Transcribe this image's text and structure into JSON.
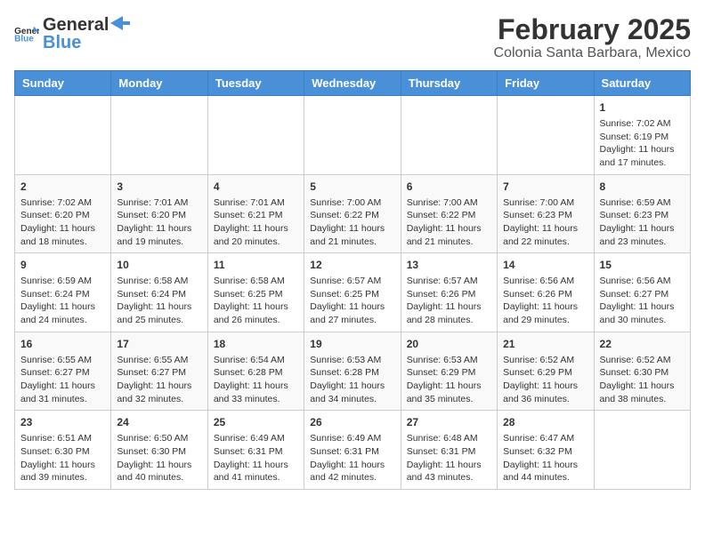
{
  "header": {
    "logo_general": "General",
    "logo_blue": "Blue",
    "title": "February 2025",
    "subtitle": "Colonia Santa Barbara, Mexico"
  },
  "weekdays": [
    "Sunday",
    "Monday",
    "Tuesday",
    "Wednesday",
    "Thursday",
    "Friday",
    "Saturday"
  ],
  "weeks": [
    [
      {
        "day": "",
        "info": ""
      },
      {
        "day": "",
        "info": ""
      },
      {
        "day": "",
        "info": ""
      },
      {
        "day": "",
        "info": ""
      },
      {
        "day": "",
        "info": ""
      },
      {
        "day": "",
        "info": ""
      },
      {
        "day": "1",
        "info": "Sunrise: 7:02 AM\nSunset: 6:19 PM\nDaylight: 11 hours and 17 minutes."
      }
    ],
    [
      {
        "day": "2",
        "info": "Sunrise: 7:02 AM\nSunset: 6:20 PM\nDaylight: 11 hours and 18 minutes."
      },
      {
        "day": "3",
        "info": "Sunrise: 7:01 AM\nSunset: 6:20 PM\nDaylight: 11 hours and 19 minutes."
      },
      {
        "day": "4",
        "info": "Sunrise: 7:01 AM\nSunset: 6:21 PM\nDaylight: 11 hours and 20 minutes."
      },
      {
        "day": "5",
        "info": "Sunrise: 7:00 AM\nSunset: 6:22 PM\nDaylight: 11 hours and 21 minutes."
      },
      {
        "day": "6",
        "info": "Sunrise: 7:00 AM\nSunset: 6:22 PM\nDaylight: 11 hours and 21 minutes."
      },
      {
        "day": "7",
        "info": "Sunrise: 7:00 AM\nSunset: 6:23 PM\nDaylight: 11 hours and 22 minutes."
      },
      {
        "day": "8",
        "info": "Sunrise: 6:59 AM\nSunset: 6:23 PM\nDaylight: 11 hours and 23 minutes."
      }
    ],
    [
      {
        "day": "9",
        "info": "Sunrise: 6:59 AM\nSunset: 6:24 PM\nDaylight: 11 hours and 24 minutes."
      },
      {
        "day": "10",
        "info": "Sunrise: 6:58 AM\nSunset: 6:24 PM\nDaylight: 11 hours and 25 minutes."
      },
      {
        "day": "11",
        "info": "Sunrise: 6:58 AM\nSunset: 6:25 PM\nDaylight: 11 hours and 26 minutes."
      },
      {
        "day": "12",
        "info": "Sunrise: 6:57 AM\nSunset: 6:25 PM\nDaylight: 11 hours and 27 minutes."
      },
      {
        "day": "13",
        "info": "Sunrise: 6:57 AM\nSunset: 6:26 PM\nDaylight: 11 hours and 28 minutes."
      },
      {
        "day": "14",
        "info": "Sunrise: 6:56 AM\nSunset: 6:26 PM\nDaylight: 11 hours and 29 minutes."
      },
      {
        "day": "15",
        "info": "Sunrise: 6:56 AM\nSunset: 6:27 PM\nDaylight: 11 hours and 30 minutes."
      }
    ],
    [
      {
        "day": "16",
        "info": "Sunrise: 6:55 AM\nSunset: 6:27 PM\nDaylight: 11 hours and 31 minutes."
      },
      {
        "day": "17",
        "info": "Sunrise: 6:55 AM\nSunset: 6:27 PM\nDaylight: 11 hours and 32 minutes."
      },
      {
        "day": "18",
        "info": "Sunrise: 6:54 AM\nSunset: 6:28 PM\nDaylight: 11 hours and 33 minutes."
      },
      {
        "day": "19",
        "info": "Sunrise: 6:53 AM\nSunset: 6:28 PM\nDaylight: 11 hours and 34 minutes."
      },
      {
        "day": "20",
        "info": "Sunrise: 6:53 AM\nSunset: 6:29 PM\nDaylight: 11 hours and 35 minutes."
      },
      {
        "day": "21",
        "info": "Sunrise: 6:52 AM\nSunset: 6:29 PM\nDaylight: 11 hours and 36 minutes."
      },
      {
        "day": "22",
        "info": "Sunrise: 6:52 AM\nSunset: 6:30 PM\nDaylight: 11 hours and 38 minutes."
      }
    ],
    [
      {
        "day": "23",
        "info": "Sunrise: 6:51 AM\nSunset: 6:30 PM\nDaylight: 11 hours and 39 minutes."
      },
      {
        "day": "24",
        "info": "Sunrise: 6:50 AM\nSunset: 6:30 PM\nDaylight: 11 hours and 40 minutes."
      },
      {
        "day": "25",
        "info": "Sunrise: 6:49 AM\nSunset: 6:31 PM\nDaylight: 11 hours and 41 minutes."
      },
      {
        "day": "26",
        "info": "Sunrise: 6:49 AM\nSunset: 6:31 PM\nDaylight: 11 hours and 42 minutes."
      },
      {
        "day": "27",
        "info": "Sunrise: 6:48 AM\nSunset: 6:31 PM\nDaylight: 11 hours and 43 minutes."
      },
      {
        "day": "28",
        "info": "Sunrise: 6:47 AM\nSunset: 6:32 PM\nDaylight: 11 hours and 44 minutes."
      },
      {
        "day": "",
        "info": ""
      }
    ]
  ]
}
